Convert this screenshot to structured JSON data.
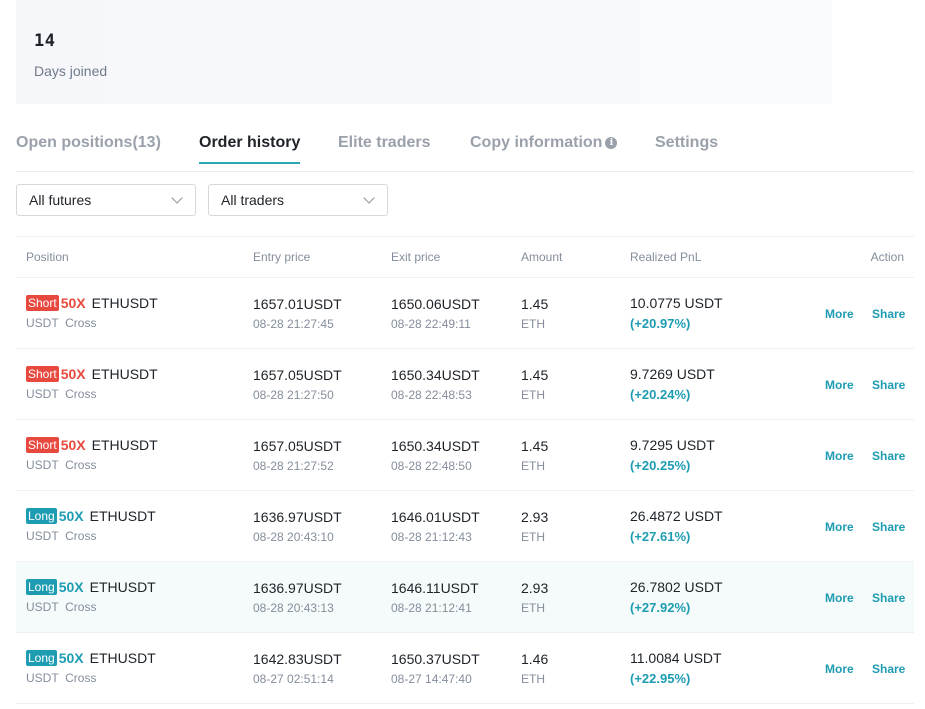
{
  "stats": {
    "value": "14",
    "label": "Days joined"
  },
  "tabs": [
    {
      "label": "Open positions(13)"
    },
    {
      "label": "Order history"
    },
    {
      "label": "Elite traders"
    },
    {
      "label": "Copy information"
    },
    {
      "label": "Settings"
    }
  ],
  "active_tab": "Order history",
  "filters": {
    "futures": "All futures",
    "traders": "All traders"
  },
  "table": {
    "headers": {
      "position": "Position",
      "entry": "Entry price",
      "exit": "Exit price",
      "amount": "Amount",
      "pnl": "Realized PnL",
      "action": "Action"
    },
    "rows": [
      {
        "side": "Short",
        "leverage": "50X",
        "symbol": "ETHUSDT",
        "margin": "USDT  Cross",
        "entry_price": "1657.01USDT",
        "entry_time": "08-28 21:27:45",
        "exit_price": "1650.06USDT",
        "exit_time": "08-28 22:49:11",
        "amount": "1.45",
        "amount_unit": "ETH",
        "pnl": "10.0775 USDT",
        "pnl_pct": "(+20.97%)",
        "more": "More",
        "share": "Share"
      },
      {
        "side": "Short",
        "leverage": "50X",
        "symbol": "ETHUSDT",
        "margin": "USDT  Cross",
        "entry_price": "1657.05USDT",
        "entry_time": "08-28 21:27:50",
        "exit_price": "1650.34USDT",
        "exit_time": "08-28 22:48:53",
        "amount": "1.45",
        "amount_unit": "ETH",
        "pnl": "9.7269 USDT",
        "pnl_pct": "(+20.24%)",
        "more": "More",
        "share": "Share"
      },
      {
        "side": "Short",
        "leverage": "50X",
        "symbol": "ETHUSDT",
        "margin": "USDT  Cross",
        "entry_price": "1657.05USDT",
        "entry_time": "08-28 21:27:52",
        "exit_price": "1650.34USDT",
        "exit_time": "08-28 22:48:50",
        "amount": "1.45",
        "amount_unit": "ETH",
        "pnl": "9.7295 USDT",
        "pnl_pct": "(+20.25%)",
        "more": "More",
        "share": "Share"
      },
      {
        "side": "Long",
        "leverage": "50X",
        "symbol": "ETHUSDT",
        "margin": "USDT  Cross",
        "entry_price": "1636.97USDT",
        "entry_time": "08-28 20:43:10",
        "exit_price": "1646.01USDT",
        "exit_time": "08-28 21:12:43",
        "amount": "2.93",
        "amount_unit": "ETH",
        "pnl": "26.4872 USDT",
        "pnl_pct": "(+27.61%)",
        "more": "More",
        "share": "Share"
      },
      {
        "side": "Long",
        "leverage": "50X",
        "symbol": "ETHUSDT",
        "margin": "USDT  Cross",
        "entry_price": "1636.97USDT",
        "entry_time": "08-28 20:43:13",
        "exit_price": "1646.11USDT",
        "exit_time": "08-28 21:12:41",
        "amount": "2.93",
        "amount_unit": "ETH",
        "pnl": "26.7802 USDT",
        "pnl_pct": "(+27.92%)",
        "more": "More",
        "share": "Share"
      },
      {
        "side": "Long",
        "leverage": "50X",
        "symbol": "ETHUSDT",
        "margin": "USDT  Cross",
        "entry_price": "1642.83USDT",
        "entry_time": "08-27 02:51:14",
        "exit_price": "1650.37USDT",
        "exit_time": "08-27 14:47:40",
        "amount": "1.46",
        "amount_unit": "ETH",
        "pnl": "11.0084 USDT",
        "pnl_pct": "(+22.95%)",
        "more": "More",
        "share": "Share"
      }
    ]
  },
  "colors": {
    "accent": "#1d9cb2",
    "short": "#e8493e",
    "long": "#1d9cb2"
  },
  "icons": {
    "tab_info": "info-icon",
    "dropdown": "chevron-down-icon"
  }
}
